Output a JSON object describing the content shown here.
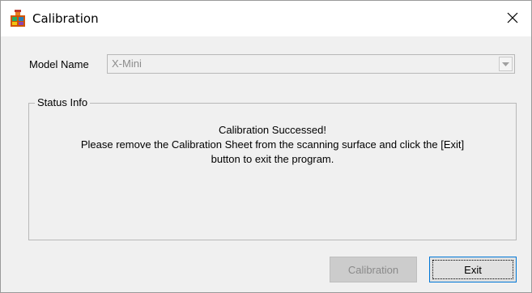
{
  "window": {
    "title": "Calibration",
    "app_icon": "scanner-app-icon",
    "close_icon": "close-icon"
  },
  "model": {
    "label": "Model Name",
    "selected_value": "X-Mini",
    "dropdown_icon": "chevron-down-icon",
    "enabled": false
  },
  "status": {
    "group_title": "Status Info",
    "lines": [
      "Calibration Successed!",
      "Please remove the Calibration Sheet from the scanning surface and click the [Exit]",
      "button to exit the program."
    ]
  },
  "buttons": {
    "calibration_label": "Calibration",
    "calibration_enabled": false,
    "exit_label": "Exit"
  },
  "colors": {
    "window_bg": "#f0f0f0",
    "titlebar_bg": "#ffffff",
    "focus_border": "#0078d7",
    "disabled_text": "#8a8a8a"
  }
}
